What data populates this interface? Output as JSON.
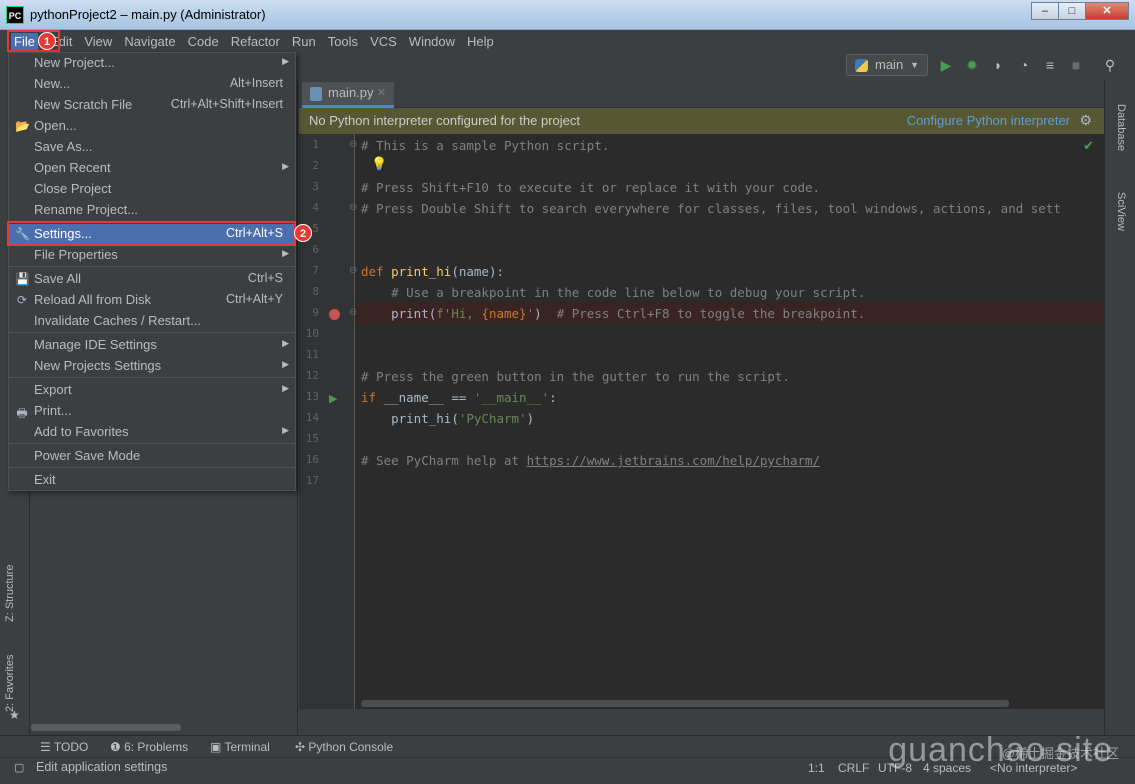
{
  "window": {
    "title": "pythonProject2 – main.py (Administrator)",
    "app_icon": "PC",
    "buttons": [
      "–",
      "□",
      "✕"
    ]
  },
  "menubar": [
    "File",
    "Edit",
    "View",
    "Navigate",
    "Code",
    "Refactor",
    "Run",
    "Tools",
    "VCS",
    "Window",
    "Help"
  ],
  "annotations": {
    "step1": "1",
    "step2": "2"
  },
  "toolbar": {
    "run_config": "main"
  },
  "file_menu": {
    "new_project": "New Project...",
    "new": "New...",
    "new_sc": "Alt+Insert",
    "new_scratch": "New Scratch File",
    "new_scratch_sc": "Ctrl+Alt+Shift+Insert",
    "open": "Open...",
    "save_as": "Save As...",
    "open_recent": "Open Recent",
    "close_project": "Close Project",
    "rename_project": "Rename Project...",
    "settings": "Settings...",
    "settings_sc": "Ctrl+Alt+S",
    "file_properties": "File Properties",
    "save_all": "Save All",
    "save_all_sc": "Ctrl+S",
    "reload": "Reload All from Disk",
    "reload_sc": "Ctrl+Alt+Y",
    "invalidate": "Invalidate Caches / Restart...",
    "manage_ide": "Manage IDE Settings",
    "new_projects_settings": "New Projects Settings",
    "export": "Export",
    "print": "Print...",
    "add_favorites": "Add to Favorites",
    "power_save": "Power Save Mode",
    "exit": "Exit"
  },
  "editor": {
    "tab": "main.py",
    "banner": "No Python interpreter configured for the project",
    "banner_link": "Configure Python interpreter",
    "line_numbers": [
      "1",
      "2",
      "3",
      "4",
      "5",
      "6",
      "7",
      "8",
      "9",
      "10",
      "11",
      "12",
      "13",
      "14",
      "15",
      "16",
      "17"
    ],
    "code": {
      "l1": "# This is a sample Python script.",
      "l3": "# Press Shift+F10 to execute it or replace it with your code.",
      "l4": "# Press Double Shift to search everywhere for classes, files, tool windows, actions, and sett",
      "l7_kw": "def",
      "l7_fn": "print_hi",
      "l7_rest": "(name):",
      "l8": "# Use a breakpoint in the code line below to debug your script.",
      "l9_a": "print(",
      "l9_s1": "f'Hi, ",
      "l9_b": "{name}",
      "l9_s2": "'",
      "l9_c": ")",
      "l9_cm": "# Press Ctrl+F8 to toggle the breakpoint.",
      "l12": "# Press the green button in the gutter to run the script.",
      "l13_kw": "if",
      "l13_a": " __name__ == ",
      "l13_s": "'__main__'",
      "l13_b": ":",
      "l14_a": "print_hi(",
      "l14_s": "'PyCharm'",
      "l14_b": ")",
      "l16_c": "# See PyCharm help at ",
      "l16_u": "https://www.jetbrains.com/help/pycharm/"
    }
  },
  "side": {
    "structure": "Z: Structure",
    "favorites": "2: Favorites",
    "database": "Database",
    "sciview": "SciView"
  },
  "bottom_tabs": {
    "todo": "TODO",
    "problems": "6: Problems",
    "terminal": "Terminal",
    "python_console": "Python Console"
  },
  "status": {
    "message": "Edit application settings",
    "position": "1:1",
    "line_sep": "CRLF",
    "encoding": "UTF-8",
    "indent": "4 spaces",
    "interpreter": "<No interpreter>"
  },
  "watermark": {
    "main": "guanchao site",
    "sub": "@稀土掘金技术社区"
  }
}
